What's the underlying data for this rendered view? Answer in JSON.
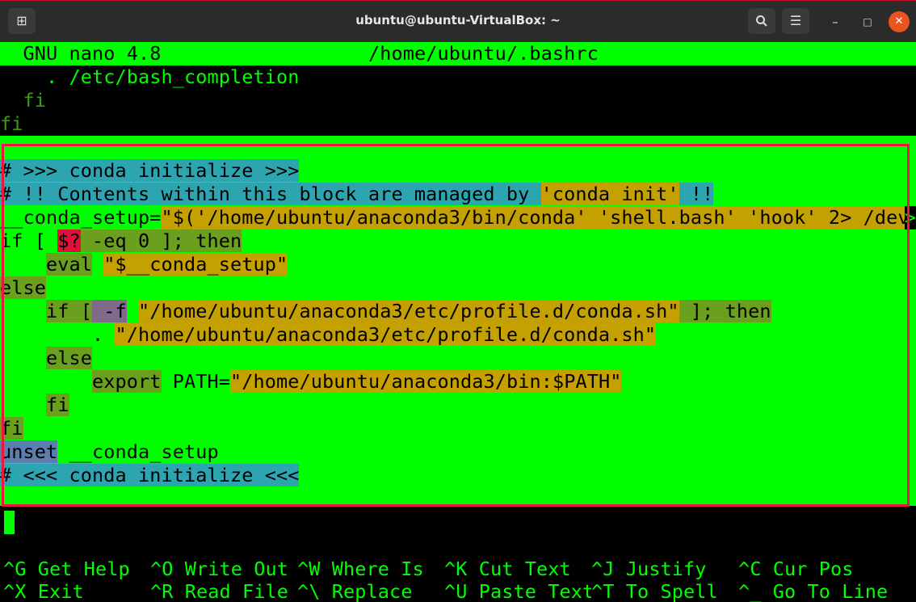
{
  "window": {
    "title": "ubuntu@ubuntu-VirtualBox: ~",
    "icons": [
      "new-tab-icon",
      "search-icon",
      "menu-icon",
      "minimize-icon",
      "maximize-icon",
      "close-icon"
    ]
  },
  "nano": {
    "version": "GNU nano 4.8",
    "file": "/home/ubuntu/.bashrc"
  },
  "lines": {
    "l1": "    . /etc/bash_completion",
    "l2": "  fi",
    "l3": "fi",
    "c1": "# >>> conda initialize >>>",
    "c2a": "# !! Contents within this block are managed by ",
    "c2b": "'conda init'",
    "c2c": " !!",
    "c3a": "__conda_setup=",
    "c3b": "\"$('/home/ubuntu/anaconda3/bin/conda' 'shell.bash' 'hook' 2> /dev",
    "c3more": ">",
    "c4a": "if [ ",
    "c4b": "$?",
    "c4c": " -eq 0 ]; ",
    "c4d": "then",
    "c5a": "    ",
    "c5b": "eval",
    "c5c": " ",
    "c5d": "\"$__conda_setup\"",
    "c6": "else",
    "c7a": "    ",
    "c7b": "if [",
    "c7c": " -f",
    "c7d": " ",
    "c7e": "\"/home/ubuntu/anaconda3/etc/profile.d/conda.sh\"",
    "c7f": " ]; ",
    "c7g": "then",
    "c8a": "        . ",
    "c8b": "\"/home/ubuntu/anaconda3/etc/profile.d/conda.sh\"",
    "c9a": "    ",
    "c9b": "else",
    "c10a": "        ",
    "c10b": "export",
    "c10c": " PATH=",
    "c10d": "\"/home/ubuntu/anaconda3/bin:$PATH\"",
    "c11a": "    ",
    "c11b": "fi",
    "c12": "fi",
    "c13a": "unset",
    "c13b": " __conda_setup",
    "c14": "# <<< conda initialize <<<"
  },
  "shortcuts": [
    {
      "key": "^G",
      "label": "Get Help"
    },
    {
      "key": "^O",
      "label": "Write Out"
    },
    {
      "key": "^W",
      "label": "Where Is"
    },
    {
      "key": "^K",
      "label": "Cut Text"
    },
    {
      "key": "^J",
      "label": "Justify"
    },
    {
      "key": "^C",
      "label": "Cur Pos"
    },
    {
      "key": "^X",
      "label": "Exit"
    },
    {
      "key": "^R",
      "label": "Read File"
    },
    {
      "key": "^\\",
      "label": "Replace"
    },
    {
      "key": "^U",
      "label": "Paste Text"
    },
    {
      "key": "^T",
      "label": "To Spell"
    },
    {
      "key": "^_",
      "label": "Go To Line"
    }
  ],
  "colors": {
    "terminal_bg": "#000000",
    "nano_green": "#00ff00",
    "selection_border": "#e8193c",
    "titlebar": "#2b2b2b",
    "close_button": "#e95420"
  }
}
